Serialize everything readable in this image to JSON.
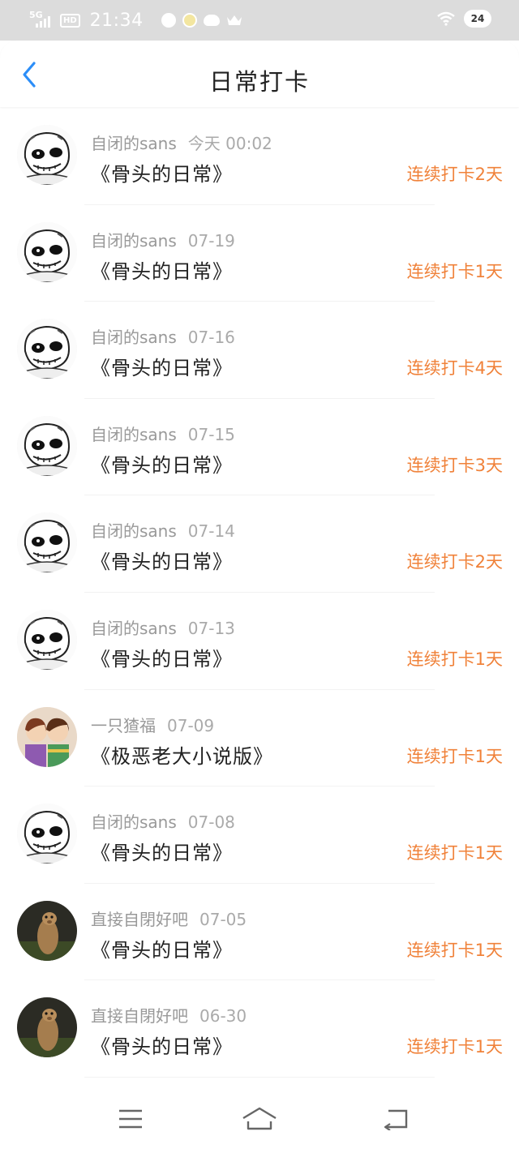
{
  "status_bar": {
    "network": "5G",
    "hd": "HD",
    "time": "21:34",
    "battery": "24"
  },
  "header": {
    "title": "日常打卡"
  },
  "checkins": [
    {
      "user": "自闭的sans",
      "date": "今天  00:02",
      "book": "《骨头的日常》",
      "streak": "连续打卡2天",
      "avatar": "sans-avatar"
    },
    {
      "user": "自闭的sans",
      "date": "07-19",
      "book": "《骨头的日常》",
      "streak": "连续打卡1天",
      "avatar": "sans-avatar"
    },
    {
      "user": "自闭的sans",
      "date": "07-16",
      "book": "《骨头的日常》",
      "streak": "连续打卡4天",
      "avatar": "sans-avatar"
    },
    {
      "user": "自闭的sans",
      "date": "07-15",
      "book": "《骨头的日常》",
      "streak": "连续打卡3天",
      "avatar": "sans-avatar"
    },
    {
      "user": "自闭的sans",
      "date": "07-14",
      "book": "《骨头的日常》",
      "streak": "连续打卡2天",
      "avatar": "sans-avatar"
    },
    {
      "user": "自闭的sans",
      "date": "07-13",
      "book": "《骨头的日常》",
      "streak": "连续打卡1天",
      "avatar": "sans-avatar"
    },
    {
      "user": "一只猹福",
      "date": "07-09",
      "book": "《极恶老大小说版》",
      "streak": "连续打卡1天",
      "avatar": "two-kids-avatar"
    },
    {
      "user": "自闭的sans",
      "date": "07-08",
      "book": "《骨头的日常》",
      "streak": "连续打卡1天",
      "avatar": "sans-avatar"
    },
    {
      "user": "直接自閉好吧",
      "date": "07-05",
      "book": "《骨头的日常》",
      "streak": "连续打卡1天",
      "avatar": "marmot-avatar"
    },
    {
      "user": "直接自閉好吧",
      "date": "06-30",
      "book": "《骨头的日常》",
      "streak": "连续打卡1天",
      "avatar": "marmot-avatar"
    }
  ],
  "colors": {
    "accent": "#f0823a",
    "back": "#2c8ef8",
    "statusbar": "#dcdcdc"
  },
  "icons": {
    "back": "chevron-left-icon",
    "menu": "menu-icon",
    "home": "home-icon",
    "return": "return-icon"
  }
}
